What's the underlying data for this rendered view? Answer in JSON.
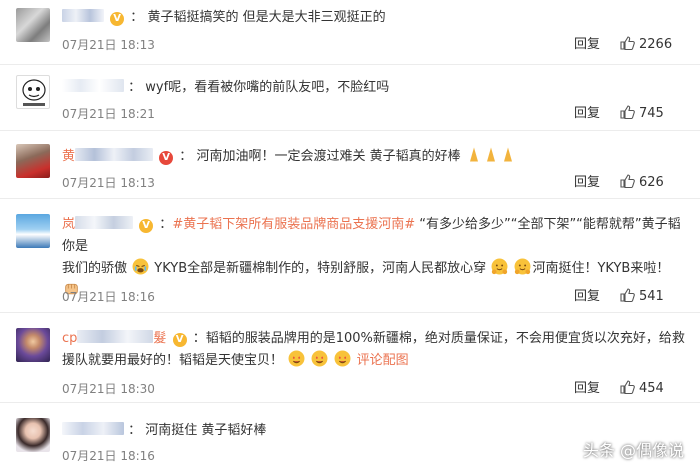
{
  "comments": [
    {
      "user_prefix": "",
      "badge": "V",
      "text": "黄子韬挺搞笑的 但是大是大非三观挺正的",
      "time": "07月21日 18:13",
      "reply": "回复",
      "likes": "2266"
    },
    {
      "user_prefix": "",
      "badge": "",
      "text": "wyf呢，看看被你嘴的前队友吧，不脸红吗",
      "time": "07月21日 18:21",
      "reply": "回复",
      "likes": "745"
    },
    {
      "user_prefix": "黄",
      "badge": "V",
      "text": "河南加油啊！一定会渡过难关 黄子韬真的好棒",
      "time": "07月21日 18:13",
      "reply": "回复",
      "likes": "626"
    },
    {
      "user_prefix": "岚",
      "badge": "V",
      "topic": "#黄子韬下架所有服装品牌商品支援河南#",
      "text_a": " “有多少给多少”“全部下架”“能帮就帮”黄子韬你是",
      "text_b": "我们的骄傲",
      "text_c": "YKYB全部是新疆棉制作的，特别舒服，河南人民都放心穿",
      "text_d": "河南挺住！YKYB来啦！",
      "time": "07月21日 18:16",
      "reply": "回复",
      "likes": "541"
    },
    {
      "user_prefix": "cp",
      "user_suffix": "髮",
      "badge": "V",
      "text_a": "韬韬的服装品牌用的是100%新疆棉，绝对质量保证，不会用便宜货以次充好，给救",
      "text_b": "援队就要用最好的！韬韬是天使宝贝！",
      "link": "评论配图",
      "time": "07月21日 18:30",
      "reply": "回复",
      "likes": "454"
    },
    {
      "user_prefix": "",
      "badge": "",
      "text": "河南挺住 黄子韬好棒",
      "time": "07月21日 18:16",
      "reply": "",
      "likes": ""
    }
  ],
  "watermark": "头条 @偶像说"
}
